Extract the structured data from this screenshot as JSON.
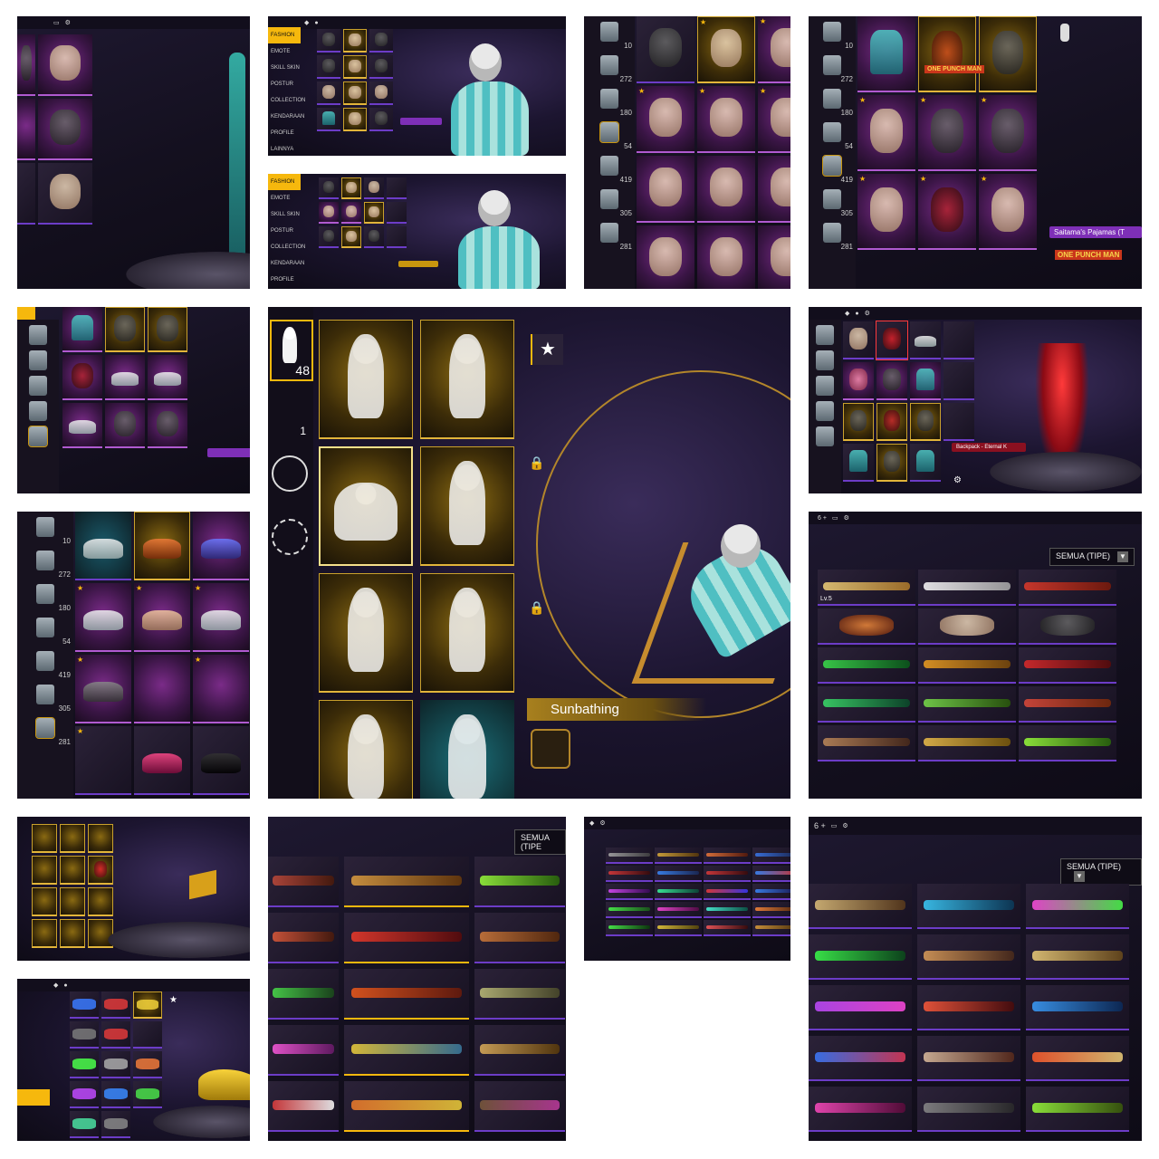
{
  "ui": {
    "accent": "#f6b80d",
    "rarity_purple": "#6c3cc7",
    "rarity_gold": "#e2b53a"
  },
  "panel_mask_inventory": {
    "counts": [
      "10",
      "272",
      "180",
      "54",
      "419",
      "305",
      "281"
    ]
  },
  "panel_top_jacket": {
    "counts": [
      "10",
      "272",
      "180",
      "54",
      "419",
      "305",
      "281"
    ],
    "banner_tag": "ONE PUNCH MAN",
    "item_name": "Saitama's Pajamas (T",
    "item_name_tag": "ONE PUNCH MAN"
  },
  "panel_preview1": {
    "nav": [
      "FASHION",
      "EMOTE",
      "SKILL SKIN",
      "POSTUR",
      "COLLECTION",
      "KENDARAAN",
      "PROFILE",
      "LAINNYA"
    ]
  },
  "panel_preview2": {
    "nav": [
      "FASHION",
      "EMOTE",
      "SKILL SKIN",
      "POSTUR",
      "COLLECTION",
      "KENDARAAN",
      "PROFILE"
    ]
  },
  "panel_emote": {
    "count_top": "48",
    "count_second": "1",
    "emote_name": "Sunbathing"
  },
  "panel_backpack": {
    "item_name": "Backpack - Eternal K"
  },
  "panel_shoes": {
    "counts": [
      "10",
      "272",
      "180",
      "54",
      "419",
      "305",
      "281"
    ]
  },
  "panel_guns_a": {
    "diamonds": "6 +",
    "filter": "SEMUA (TIPE)",
    "level_tag": "Lv.5"
  },
  "panel_guns_b": {
    "filter": "SEMUA (TIPE"
  },
  "panel_guns_d": {
    "diamonds": "6 +",
    "filter": "SEMUA (TIPE)"
  }
}
